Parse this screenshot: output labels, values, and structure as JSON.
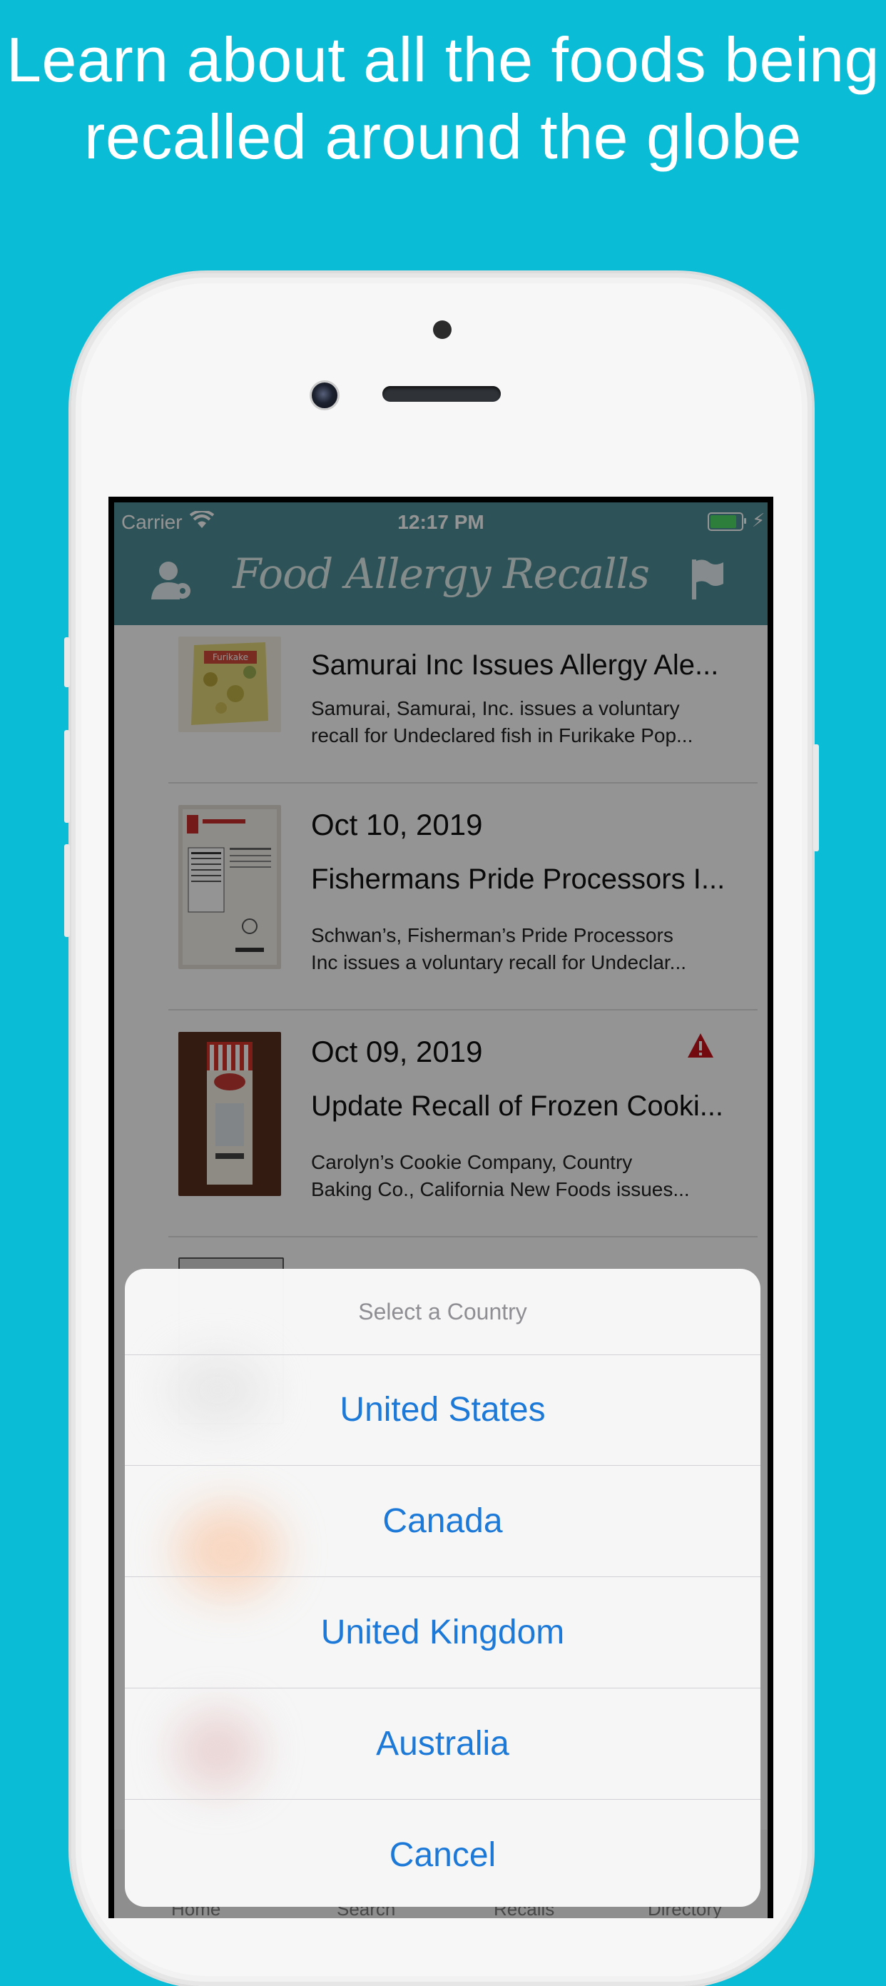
{
  "headline": {
    "line1": "Learn about all the foods being",
    "line2": "recalled around the globe"
  },
  "status_bar": {
    "carrier": "Carrier",
    "time": "12:17 PM",
    "battery_level": 0.9
  },
  "nav": {
    "title": "Food Allergy Recalls",
    "left_icon": "user-settings-icon",
    "right_icon": "flag-icon"
  },
  "recalls": [
    {
      "date": "",
      "title": "Samurai Inc Issues Allergy Ale...",
      "desc_line1": "Samurai, Samurai, Inc. issues a voluntary",
      "desc_line2": "recall for Undeclared fish in Furikake Pop...",
      "thumb_label": "Furikake",
      "alert": false
    },
    {
      "date": "Oct 10, 2019",
      "title": "Fishermans Pride Processors I...",
      "desc_line1": "Schwan’s, Fisherman’s Pride Processors",
      "desc_line2": "Inc issues a voluntary recall for Undeclar...",
      "thumb_label": "",
      "alert": false
    },
    {
      "date": "Oct 09, 2019",
      "title": "Update Recall of Frozen Cooki...",
      "desc_line1": "Carolyn’s Cookie Company, Country",
      "desc_line2": "Baking Co., California New Foods issues...",
      "thumb_label": "",
      "alert": true
    }
  ],
  "tabs": [
    "Home",
    "Search",
    "Recalls",
    "Directory"
  ],
  "action_sheet": {
    "title": "Select a Country",
    "options": [
      "United States",
      "Canada",
      "United Kingdom",
      "Australia"
    ],
    "cancel": "Cancel"
  },
  "colors": {
    "background": "#0bbcd6",
    "navbar": "#4f8f98",
    "action_text": "#1d79d8",
    "alert": "#c4121d"
  }
}
